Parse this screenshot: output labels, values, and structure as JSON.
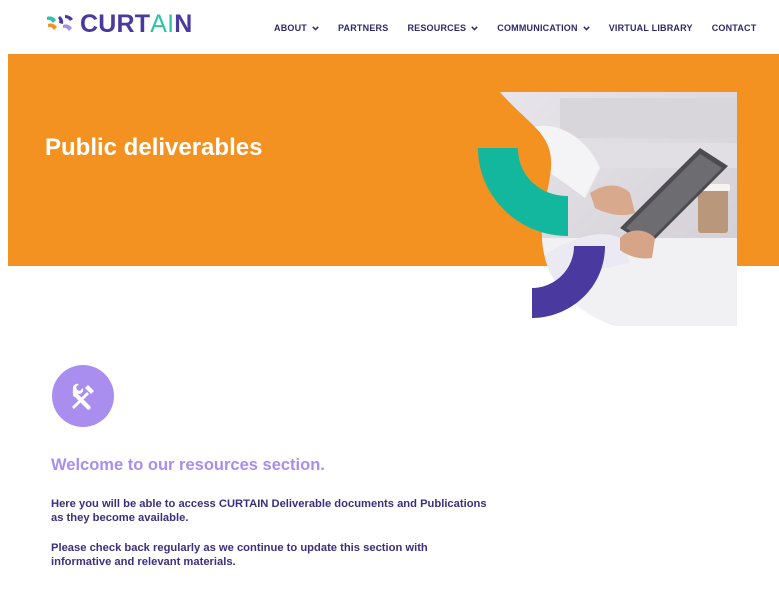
{
  "header": {
    "logo": {
      "text_curt": "CURT",
      "text_a": "A",
      "text_i": "I",
      "text_n": "N",
      "alt": "CURTAIN"
    },
    "nav": [
      {
        "label": "ABOUT",
        "has_dropdown": true
      },
      {
        "label": "PARTNERS",
        "has_dropdown": false
      },
      {
        "label": "RESOURCES",
        "has_dropdown": true
      },
      {
        "label": "COMMUNICATION",
        "has_dropdown": true
      },
      {
        "label": "VIRTUAL LIBRARY",
        "has_dropdown": false
      },
      {
        "label": "CONTACT",
        "has_dropdown": false
      }
    ]
  },
  "hero": {
    "title": "Public deliverables",
    "background_color": "#f39220"
  },
  "content": {
    "icon": "wrench-screwdriver-icon",
    "welcome": "Welcome to our resources section.",
    "paragraph1": "Here you will be able to access CURTAIN Deliverable documents and Publications as they become available.",
    "paragraph2": "Please check back regularly as we continue to update this section with informative and relevant materials."
  },
  "colors": {
    "brand_purple": "#4a3aa0",
    "brand_teal": "#2cc3a9",
    "accent_lavender": "#a98ef0",
    "orange": "#f39220",
    "text_dark": "#3c2f7f"
  }
}
